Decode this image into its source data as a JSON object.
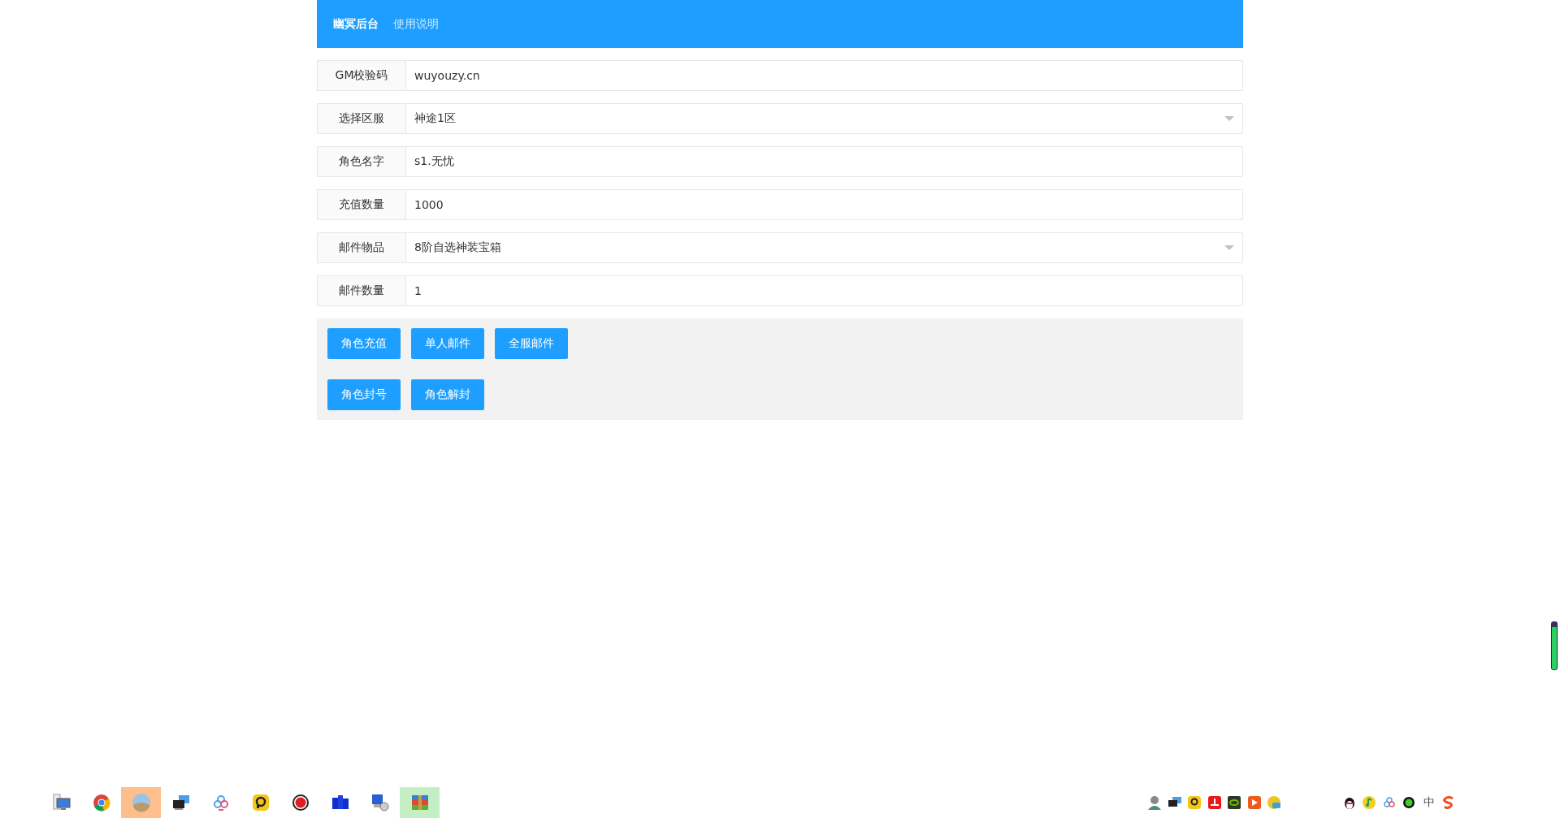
{
  "header": {
    "brand": "幽冥后台",
    "link": "使用说明"
  },
  "form_rows": [
    {
      "label": "GM校验码",
      "value": "wuyouzy.cn",
      "kind": "input"
    },
    {
      "label": "选择区服",
      "value": "神途1区",
      "kind": "select"
    },
    {
      "label": "角色名字",
      "value": "s1.无忧",
      "kind": "input"
    },
    {
      "label": "充值数量",
      "value": "1000",
      "kind": "input"
    },
    {
      "label": "邮件物品",
      "value": "8阶自选神装宝箱",
      "kind": "select"
    },
    {
      "label": "邮件数量",
      "value": "1",
      "kind": "input"
    }
  ],
  "button_rows": [
    [
      "角色充值",
      "单人邮件",
      "全服邮件"
    ],
    [
      "角色封号",
      "角色解封"
    ]
  ],
  "desktop_icons": [
    {
      "kind": "monitor"
    },
    {
      "kind": "browser"
    },
    {
      "kind": "photo",
      "color": "#ffbf8c"
    },
    {
      "kind": "screens"
    },
    {
      "kind": "cloud"
    },
    {
      "kind": "yellow"
    },
    {
      "kind": "record"
    },
    {
      "kind": "grid"
    },
    {
      "kind": "computer"
    },
    {
      "kind": "archive",
      "color": "#c4efc4"
    }
  ],
  "tray_left": [
    {
      "kind": "person"
    },
    {
      "kind": "screens"
    },
    {
      "kind": "yellow"
    },
    {
      "kind": "red"
    },
    {
      "kind": "greensq"
    },
    {
      "kind": "orange"
    },
    {
      "kind": "game"
    }
  ],
  "tray_right": [
    {
      "kind": "penguin"
    },
    {
      "kind": "music"
    },
    {
      "kind": "cloud"
    },
    {
      "kind": "dot"
    },
    {
      "kind": "ime",
      "text": "中"
    },
    {
      "kind": "sogou"
    }
  ]
}
